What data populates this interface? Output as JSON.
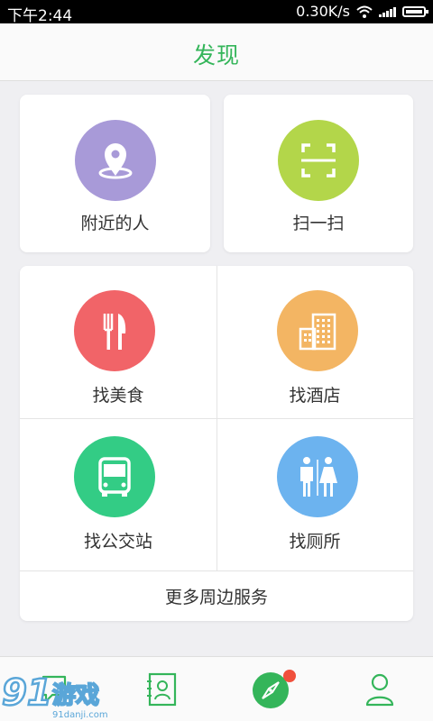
{
  "status_bar": {
    "time": "下午2:44",
    "network_speed": "0.30K/s"
  },
  "header": {
    "title": "发现"
  },
  "top_card": {
    "nearby_label": "附近的人",
    "scan_label": "扫一扫"
  },
  "services": {
    "food_label": "找美食",
    "hotel_label": "找酒店",
    "bus_label": "找公交站",
    "toilet_label": "找厕所",
    "more_label": "更多周边服务"
  },
  "colors": {
    "accent": "#34b55a",
    "nearby": "#a89ad8",
    "scan": "#b3d64a",
    "food": "#f16468",
    "hotel": "#f3b563",
    "bus": "#33cc85",
    "toilet": "#6cb3ef",
    "badge": "#f0503c"
  },
  "tabbar": {
    "icons": [
      "chat-icon",
      "contacts-icon",
      "discover-compass-icon",
      "profile-icon"
    ]
  },
  "watermark": {
    "logo_text": "91游戏",
    "site_text": "91danji.com"
  }
}
